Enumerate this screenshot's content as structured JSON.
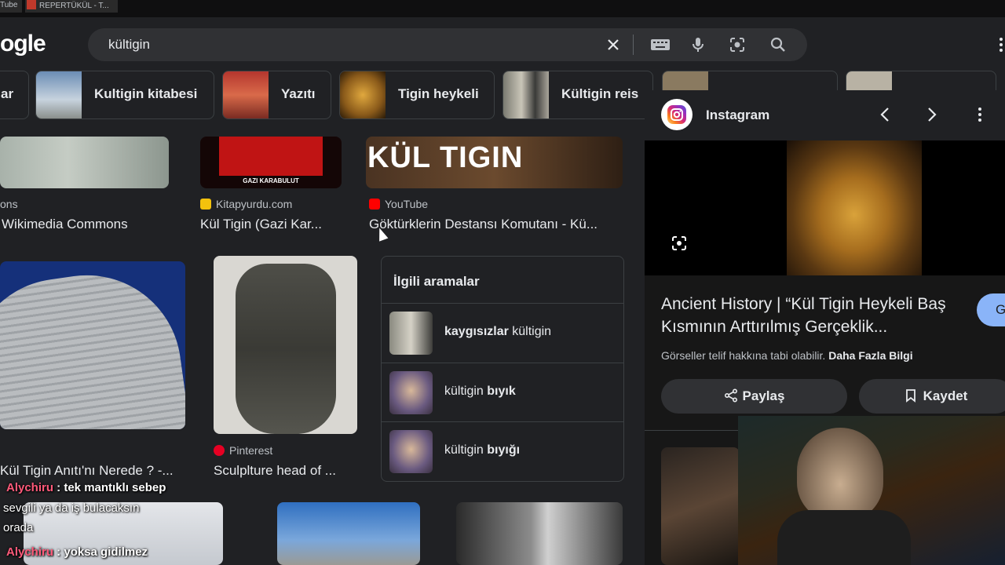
{
  "tabs": [
    {
      "label": "Tube"
    },
    {
      "label": "REPERTÜKÜL - T..."
    }
  ],
  "header": {
    "logo": "ogle",
    "search_value": "kültigin",
    "icons": [
      "close-icon",
      "keyboard-icon",
      "microphone-icon",
      "lens-icon",
      "search-icon"
    ]
  },
  "chips": [
    {
      "label": "ar"
    },
    {
      "label": "Kultigin kitabesi"
    },
    {
      "label": "Yazıtı"
    },
    {
      "label": "Tigin heykeli"
    },
    {
      "label": "Kültigin reis"
    }
  ],
  "results": {
    "r1": {
      "source": "ons",
      "title": "Wikimedia Commons"
    },
    "r2": {
      "source": "Kitapyurdu.com",
      "title": "Kül Tigin (Gazi Kar...",
      "image_caption": "GAZI KARABULUT"
    },
    "r3": {
      "source": "YouTube",
      "title": "Göktürklerin Destansı Komutanı - Kü...",
      "image_text": "KÜL TIGIN"
    },
    "r4": {
      "title": "Kül Tigin Anıtı'nı Nerede ? -..."
    },
    "r5": {
      "source": "Pinterest",
      "title": "Sculplture head of ..."
    }
  },
  "related": {
    "heading": "İlgili aramalar",
    "items": [
      {
        "bold": "kaygısızlar",
        "normal": " kültigin"
      },
      {
        "normal": "kültigin ",
        "bold": "bıyık"
      },
      {
        "normal": "kültigin ",
        "bold": "bıyığı"
      }
    ]
  },
  "chat": [
    {
      "user": "Alychiru",
      "message": " : tek mantıklı sebep"
    },
    {
      "text": "sevgili ya da iş bulacaksın"
    },
    {
      "text": "orada"
    },
    {
      "user": "Alychiru",
      "message": " : yoksa gidilmez"
    }
  ],
  "panel": {
    "site": "Instagram",
    "title": "Ancient History | “Kül Tigin Heykeli Baş Kısmının Arttırılmış Gerçeklik...",
    "visit_label": "G",
    "copyright": "Görseller telif hakkına tabi olabilir. ",
    "more_info": "Daha Fazla Bilgi",
    "share_label": "Paylaş",
    "save_label": "Kaydet"
  },
  "colors": {
    "background": "#202124",
    "accent": "#8ab4f8",
    "chat_user": "#ff5a7a",
    "youtube": "#ff0000"
  }
}
